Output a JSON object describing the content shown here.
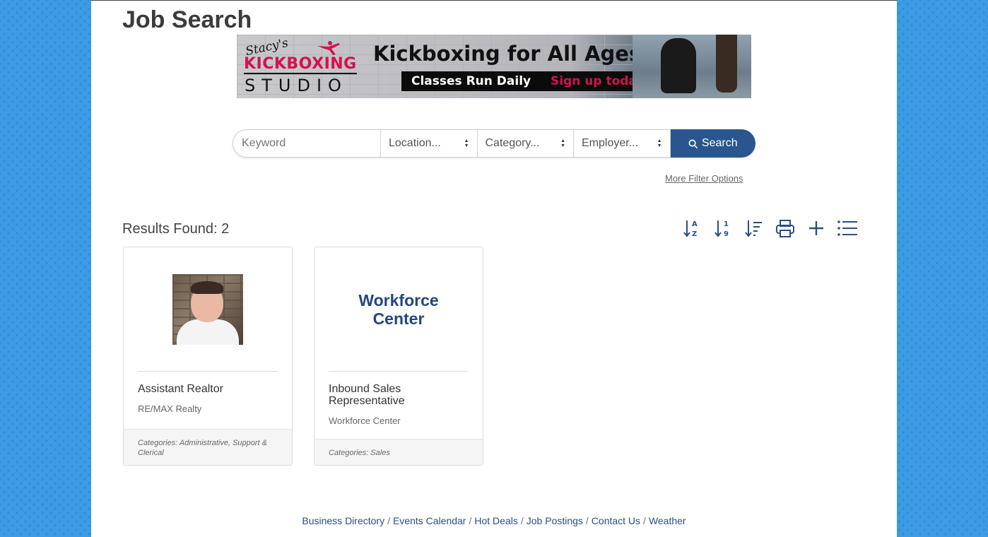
{
  "page": {
    "title": "Job Search"
  },
  "banner": {
    "brand_top": "Stacy's",
    "brand_mid": "KICKBOXING",
    "brand_bottom": "STUDIO",
    "headline": "Kickboxing for All Ages",
    "cta_left": "Classes Run Daily",
    "cta_right": "Sign up today!",
    "accent_color": "#d3124f"
  },
  "search": {
    "keyword_placeholder": "Keyword",
    "location_label": "Location...",
    "category_label": "Category...",
    "employer_label": "Employer...",
    "button_label": "Search",
    "more_filters": "More Filter Options",
    "button_color": "#2a568f"
  },
  "results": {
    "label": "Results Found:",
    "count": "2"
  },
  "toolbar": {
    "icons": [
      "sort-alpha-icon",
      "sort-numeric-icon",
      "sort-list-icon",
      "print-icon",
      "add-icon",
      "list-view-icon"
    ]
  },
  "cards": [
    {
      "title": "Assistant Realtor",
      "employer": "RE/MAX Realty",
      "categories": "Categories: Administrative, Support & Clerical",
      "media": "photo"
    },
    {
      "title": "Inbound Sales Representative",
      "employer": "Workforce Center",
      "categories": "Categories: Sales",
      "media": "logo",
      "logo_line1": "Workforce",
      "logo_line2": "Center"
    }
  ],
  "footer": {
    "links": [
      "Business Directory",
      "Events Calendar",
      "Hot Deals",
      "Job Postings",
      "Contact Us",
      "Weather"
    ],
    "separator": "/"
  }
}
